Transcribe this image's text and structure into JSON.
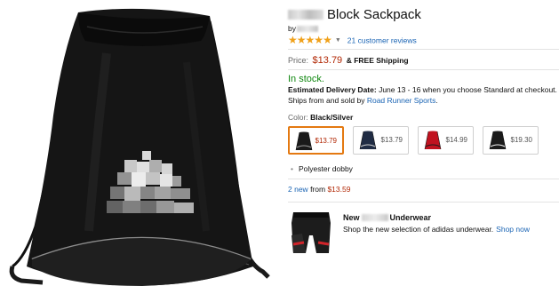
{
  "product": {
    "title": "Block Sackpack",
    "byline_prefix": "by",
    "rating": 4.5,
    "reviews_link": "21 customer reviews"
  },
  "price": {
    "label": "Price:",
    "value": "$13.79",
    "shipping": "& FREE Shipping"
  },
  "availability": {
    "stock": "In stock.",
    "delivery_label": "Estimated Delivery Date:",
    "delivery_text": "June 13 - 16 when you choose Standard at checkout.",
    "seller_prefix": "Ships from and sold by",
    "seller_name": "Road Runner Sports",
    "seller_suffix": "."
  },
  "color": {
    "label": "Color:",
    "value": "Black/Silver",
    "options": [
      {
        "price": "$13.79",
        "selected": true,
        "body": "#1a1a1a",
        "accent": "#9a9a9a"
      },
      {
        "price": "$13.79",
        "selected": false,
        "body": "#202c44",
        "accent": "#cfcfcf"
      },
      {
        "price": "$14.99",
        "selected": false,
        "body": "#c1121f",
        "accent": "#1a1a1a"
      },
      {
        "price": "$19.30",
        "selected": false,
        "body": "#1b1b1b",
        "accent": "#f2f2f2"
      }
    ]
  },
  "features": [
    "Polyester dobby"
  ],
  "offers": {
    "link": "2 new",
    "from": "from",
    "price": "$13.59"
  },
  "ad": {
    "title_prefix": "New",
    "title_suffix": "Underwear",
    "copy": "Shop the new selection of adidas underwear.",
    "link": "Shop now"
  },
  "colors": {
    "accent_price": "#b12704",
    "link": "#1a64b4",
    "in_stock": "#118811",
    "star": "#f0a11a",
    "selected_border": "#e47911"
  }
}
